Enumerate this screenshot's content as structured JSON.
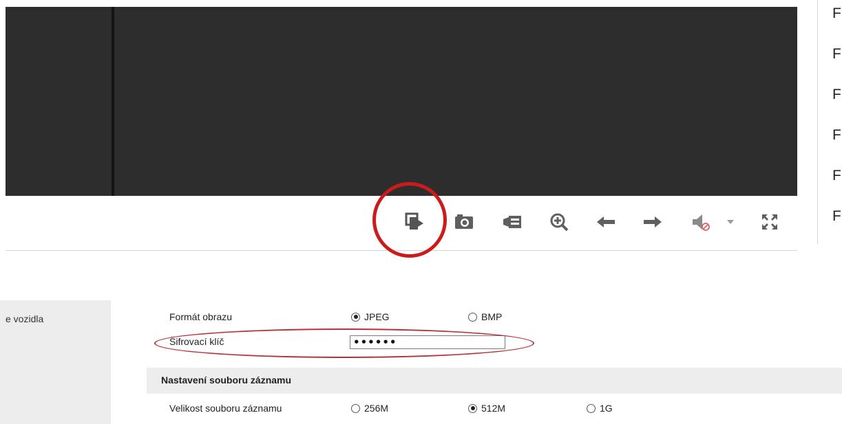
{
  "right_list": {
    "items": [
      "F",
      "F",
      "F",
      "F",
      "F",
      "F"
    ]
  },
  "toolbar": {
    "icons": [
      "playback-icon",
      "snapshot-icon",
      "record-icon",
      "zoom-in-icon",
      "arrow-left-icon",
      "arrow-right-icon",
      "audio-muted-icon",
      "dropdown-arrow-icon",
      "fullscreen-icon"
    ]
  },
  "sidebar": {
    "item_label": "e vozidla"
  },
  "settings": {
    "image_format": {
      "label": "Formát obrazu",
      "options": [
        "JPEG",
        "BMP"
      ],
      "selected": "JPEG"
    },
    "encryption_key": {
      "label": "Šifrovací klíč",
      "value": "••••••"
    },
    "record_section": {
      "title": "Nastavení souboru záznamu",
      "file_size": {
        "label": "Velikost souboru záznamu",
        "options": [
          "256M",
          "512M",
          "1G"
        ],
        "selected": "512M"
      }
    }
  },
  "colors": {
    "video_bg": "#2d2d2d",
    "highlight": "#cc1b1b",
    "panel_bg": "#ededed",
    "icon_gray": "#5f5f5f"
  }
}
